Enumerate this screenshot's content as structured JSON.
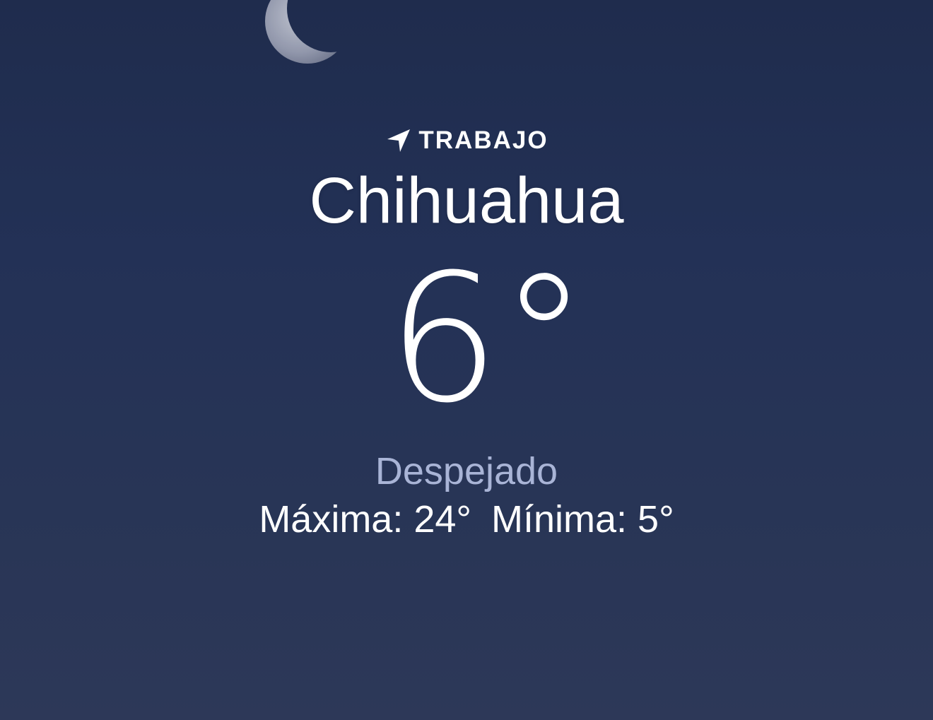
{
  "theme": {
    "sky_top": "#1f2c4d",
    "sky_bottom": "#2d3858",
    "text_primary": "#ffffff",
    "text_condition": "#a9b4d6"
  },
  "header": {
    "location_icon": "location-arrow-icon",
    "location_label": "TRABAJO",
    "city": "Chihuahua"
  },
  "current": {
    "temperature": "6°",
    "condition": "Despejado",
    "high": "Máxima: 24°",
    "low": "Mínima: 5°"
  },
  "background": {
    "moon_icon": "crescent-moon-icon"
  }
}
